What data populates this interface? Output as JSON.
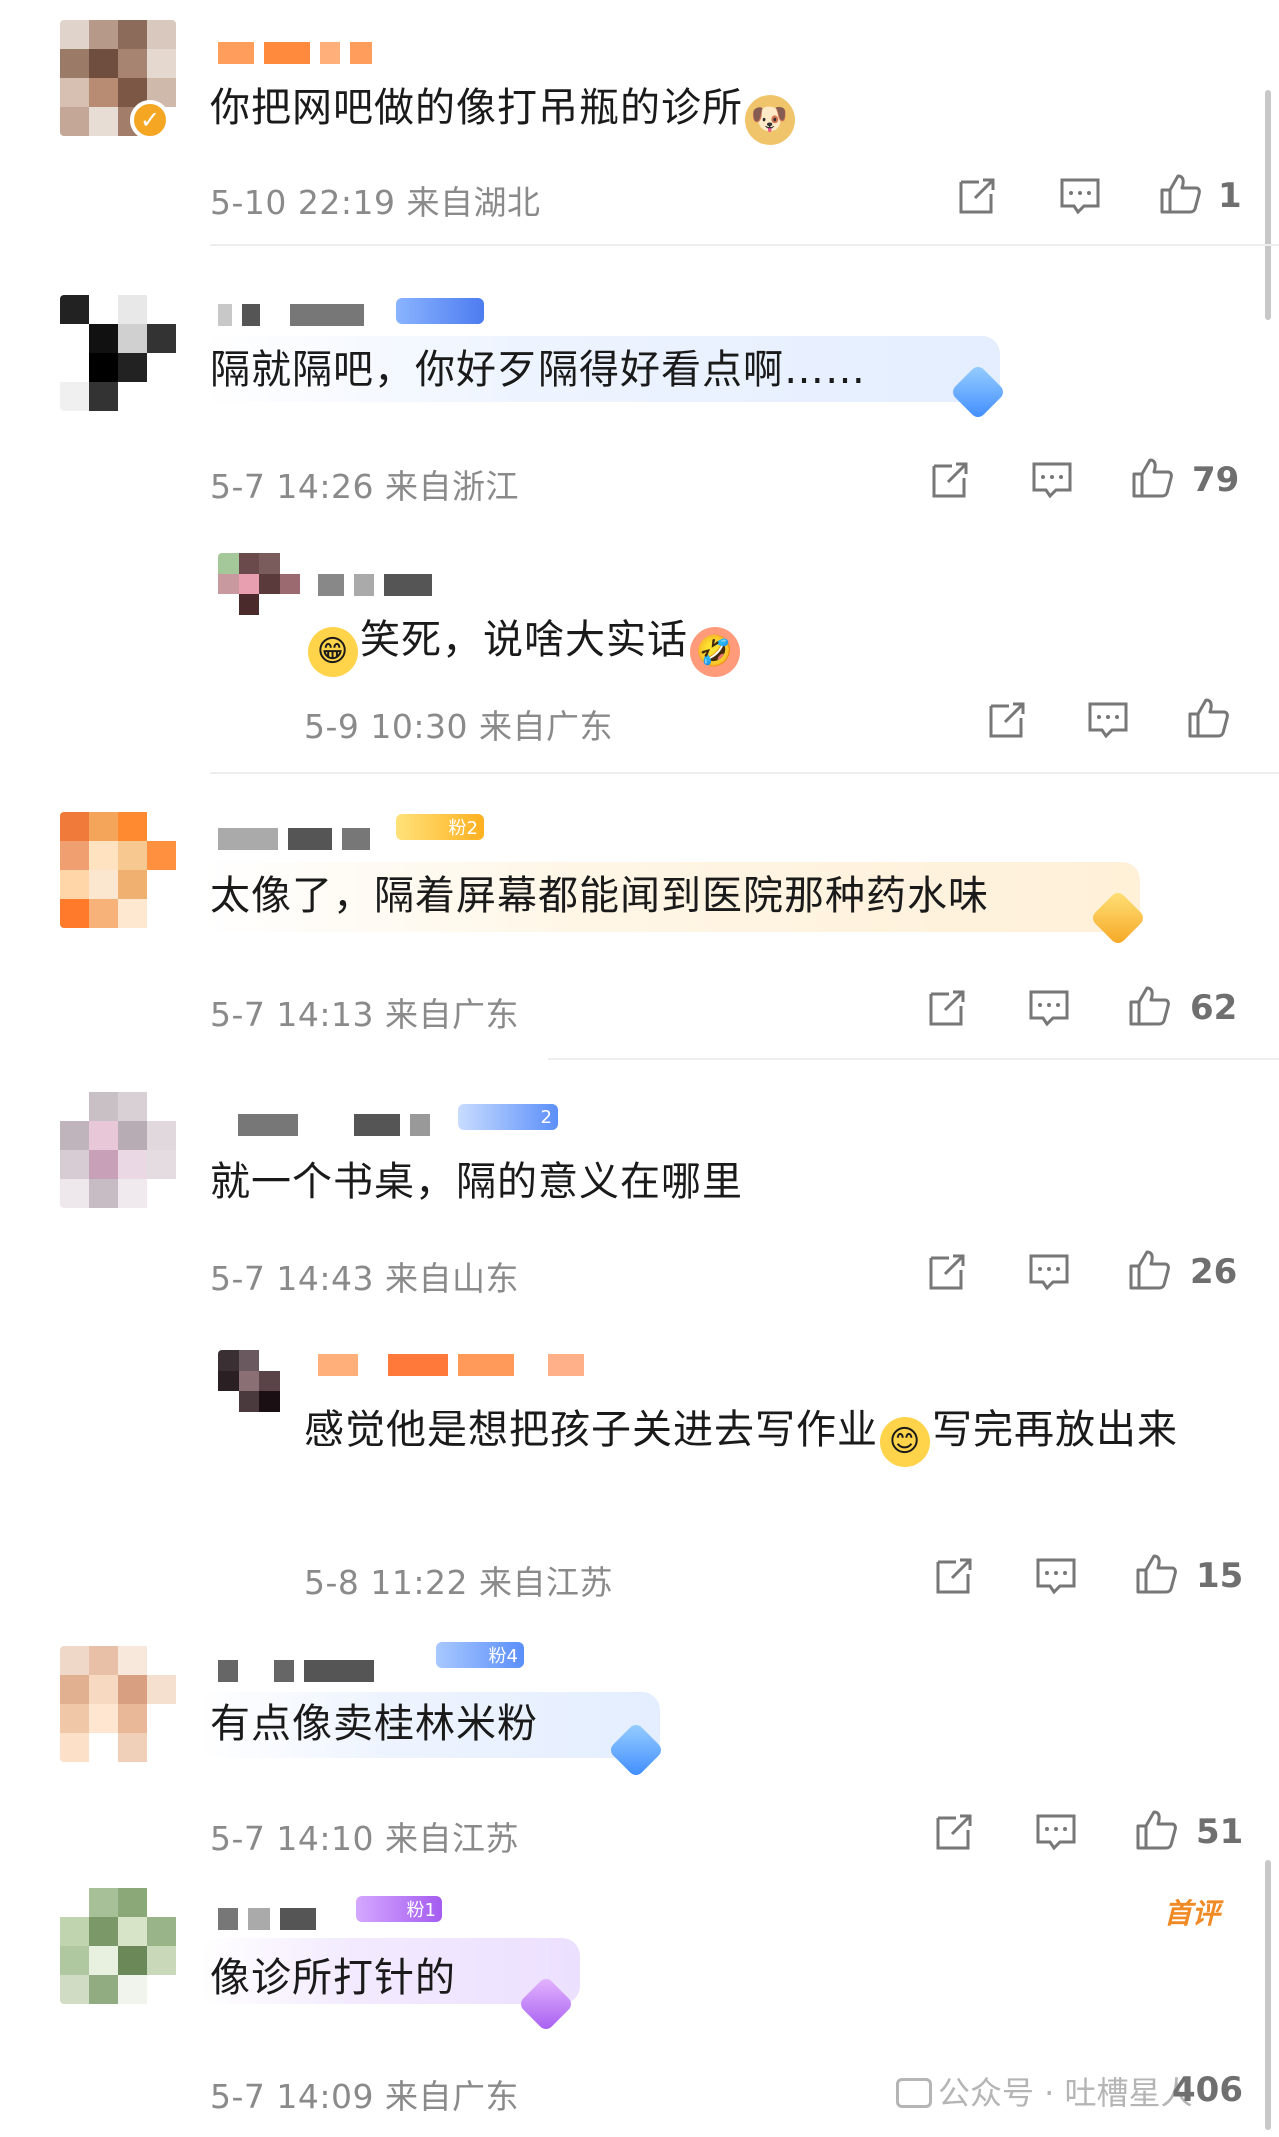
{
  "comments": [
    {
      "text": "你把网吧做的像打吊瓶的诊所",
      "emoji": "doge-emoji",
      "time": "5-10 22:19",
      "location": "来自湖北",
      "likes": "1"
    },
    {
      "text": "隔就隔吧，你好歹隔得好看点啊……",
      "time": "5-7 14:26",
      "location": "来自浙江",
      "likes": "79"
    },
    {
      "text": "笑死，说啥大实话",
      "emoji_before": "grin-emoji",
      "emoji_after": "laugh-emoji",
      "time": "5-9 10:30",
      "location": "来自广东",
      "likes": ""
    },
    {
      "text": "太像了，隔着屏幕都能闻到医院那种药水味",
      "badge": "粉2",
      "time": "5-7 14:13",
      "location": "来自广东",
      "likes": "62"
    },
    {
      "text": "就一个书桌，隔的意义在哪里",
      "badge": "2",
      "time": "5-7 14:43",
      "location": "来自山东",
      "likes": "26"
    },
    {
      "text_a": "感觉他是想把孩子关进去写作业",
      "text_b": "写完再放出来",
      "emoji": "smile-emoji",
      "time": "5-8 11:22",
      "location": "来自江苏",
      "likes": "15"
    },
    {
      "text": "有点像卖桂林米粉",
      "badge": "粉4",
      "time": "5-7 14:10",
      "location": "来自江苏",
      "likes": "51"
    },
    {
      "text": "像诊所打针的",
      "badge": "粉1",
      "first_tag": "首评",
      "time": "5-7 14:09",
      "location": "来自广东",
      "likes": "406"
    }
  ],
  "watermark": "公众号 · 吐槽星人",
  "colors": {
    "meta": "#8a8a8a",
    "accent_orange": "#f5a623",
    "blue_badge": "#5b8ff9",
    "purple_badge": "#a55cf0"
  }
}
